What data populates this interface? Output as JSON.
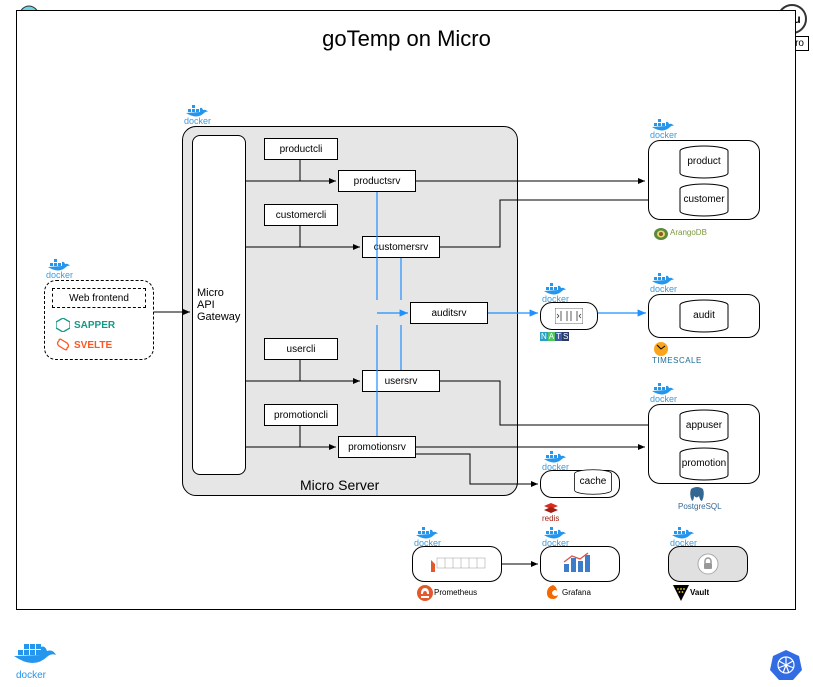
{
  "title": "goTemp on Micro",
  "badge_mu": "Mu",
  "badge_micro": "Micro",
  "frontend": {
    "label": "Web frontend",
    "tech1": "SAPPER",
    "tech2": "SVELTE"
  },
  "gateway": "Micro API Gateway",
  "server_label": "Micro Server",
  "clis": {
    "productcli": "productcli",
    "customercli": "customercli",
    "usercli": "usercli",
    "promotioncli": "promotioncli"
  },
  "srvs": {
    "productsrv": "productsrv",
    "customersrv": "customersrv",
    "auditsrv": "auditsrv",
    "usersrv": "usersrv",
    "promotionsrv": "promotionsrv"
  },
  "dbs": {
    "product": "product",
    "customer": "customer",
    "audit": "audit",
    "appuser": "appuser",
    "promotion": "promotion",
    "cache": "cache"
  },
  "tech": {
    "docker": "docker",
    "arango": "ArangoDB",
    "timescale": "TIMESCALE",
    "postgres": "PostgreSQL",
    "redis": "redis",
    "nats": "N A T S",
    "prometheus": "Prometheus",
    "grafana": "Grafana",
    "vault": "Vault"
  }
}
